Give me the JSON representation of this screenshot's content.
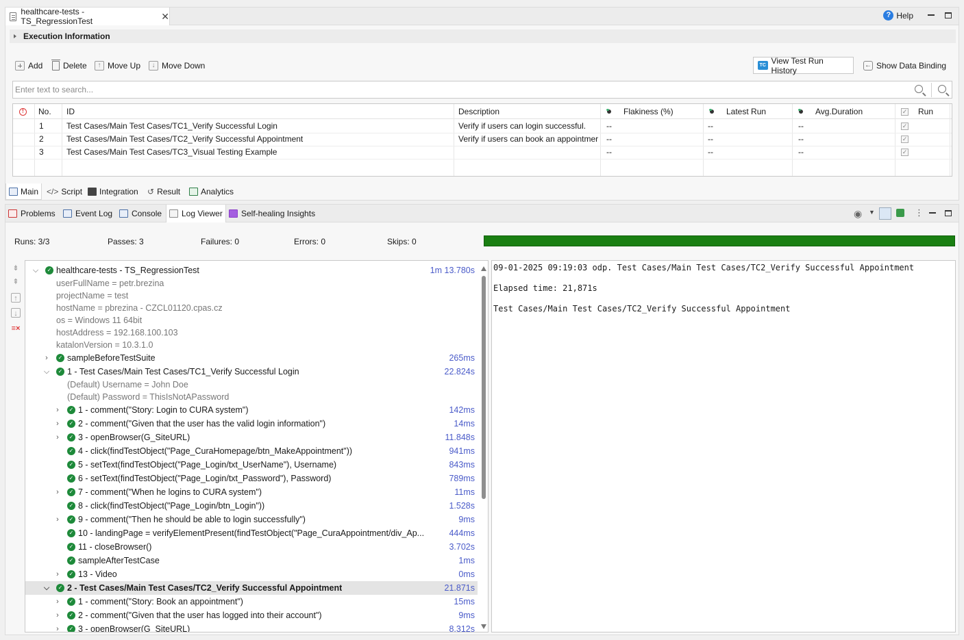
{
  "editor": {
    "tab_title": "healthcare-tests - TS_RegressionTest",
    "help_label": "Help",
    "exec_info_label": "Execution Information",
    "toolbar": {
      "add": "Add",
      "delete": "Delete",
      "move_up": "Move Up",
      "move_down": "Move Down",
      "view_history": "View Test Run History",
      "show_binding": "Show Data Binding"
    },
    "search_placeholder": "Enter text to search...",
    "columns": {
      "no": "No.",
      "id": "ID",
      "description": "Description",
      "flakiness": "Flakiness (%)",
      "latest_run": "Latest Run",
      "avg_duration": "Avg.Duration",
      "run": "Run"
    },
    "rows": [
      {
        "no": "1",
        "id": "Test Cases/Main Test Cases/TC1_Verify Successful Login",
        "description": "Verify if users can login successful.",
        "flakiness": "--",
        "latest_run": "--",
        "avg_duration": "--",
        "run": true
      },
      {
        "no": "2",
        "id": "Test Cases/Main Test Cases/TC2_Verify Successful Appointment",
        "description": "Verify if users can book an appointmer",
        "flakiness": "--",
        "latest_run": "--",
        "avg_duration": "--",
        "run": true
      },
      {
        "no": "3",
        "id": "Test Cases/Main Test Cases/TC3_Visual Testing Example",
        "description": "",
        "flakiness": "--",
        "latest_run": "--",
        "avg_duration": "--",
        "run": true
      }
    ],
    "tabs": {
      "main": "Main",
      "script": "Script",
      "integration": "Integration",
      "result": "Result",
      "analytics": "Analytics"
    }
  },
  "bottom": {
    "tabs": {
      "problems": "Problems",
      "event_log": "Event Log",
      "console": "Console",
      "log_viewer": "Log Viewer",
      "self_healing": "Self-healing Insights"
    },
    "stats": {
      "runs": "Runs: 3/3",
      "passes": "Passes: 3",
      "failures": "Failures: 0",
      "errors": "Errors: 0",
      "skips": "Skips: 0",
      "progress": 1.0
    },
    "tree": {
      "root": {
        "label": "healthcare-tests - TS_RegressionTest",
        "dur": "1m 13.780s"
      },
      "props": [
        "userFullName = petr.brezina",
        "projectName = test",
        "hostName = pbrezina - CZCL01120.cpas.cz",
        "os = Windows 11 64bit",
        "hostAddress = 192.168.100.103",
        "katalonVersion = 10.3.1.0"
      ],
      "before_suite": {
        "label": "sampleBeforeTestSuite",
        "dur": "265ms"
      },
      "tc1": {
        "label": "1  -  Test Cases/Main Test Cases/TC1_Verify Successful Login",
        "dur": "22.824s"
      },
      "tc1_vars": [
        "(Default) Username = John Doe",
        "(Default) Password = ThisIsNotAPassword"
      ],
      "tc1_steps": [
        {
          "label": "1  -  comment(\"Story: Login to CURA system\")",
          "dur": "142ms"
        },
        {
          "label": "2  -  comment(\"Given that the user has the valid login information\")",
          "dur": "14ms"
        },
        {
          "label": "3  -  openBrowser(G_SiteURL)",
          "dur": "11.848s"
        },
        {
          "label": "4  -  click(findTestObject(\"Page_CuraHomepage/btn_MakeAppointment\"))",
          "dur": "941ms"
        },
        {
          "label": "5  -  setText(findTestObject(\"Page_Login/txt_UserName\"), Username)",
          "dur": "843ms"
        },
        {
          "label": "6  -  setText(findTestObject(\"Page_Login/txt_Password\"), Password)",
          "dur": "789ms"
        },
        {
          "label": "7  -  comment(\"When he logins to CURA system\")",
          "dur": "11ms"
        },
        {
          "label": "8  -  click(findTestObject(\"Page_Login/btn_Login\"))",
          "dur": "1.528s"
        },
        {
          "label": "9  -  comment(\"Then he should be able to login successfully\")",
          "dur": "9ms"
        },
        {
          "label": "10  -  landingPage = verifyElementPresent(findTestObject(\"Page_CuraAppointment/div_Ap...",
          "dur": "444ms"
        },
        {
          "label": "11  -  closeBrowser()",
          "dur": "3.702s"
        },
        {
          "label": "sampleAfterTestCase",
          "dur": "1ms"
        },
        {
          "label": "13  -  Video",
          "dur": "0ms"
        }
      ],
      "tc2": {
        "label": "2  -  Test Cases/Main Test Cases/TC2_Verify Successful Appointment",
        "dur": "21.871s"
      },
      "tc2_steps": [
        {
          "label": "1  -  comment(\"Story: Book an appointment\")",
          "dur": "15ms"
        },
        {
          "label": "2  -  comment(\"Given that the user has logged into their account\")",
          "dur": "9ms"
        },
        {
          "label": "3  -  openBrowser(G_SiteURL)",
          "dur": "8.312s"
        }
      ]
    },
    "log": {
      "line1": "09-01-2025 09:19:03 odp. Test Cases/Main Test Cases/TC2_Verify Successful Appointment",
      "line2": "Elapsed time: 21,871s",
      "line3": "Test Cases/Main Test Cases/TC2_Verify Successful Appointment"
    }
  }
}
